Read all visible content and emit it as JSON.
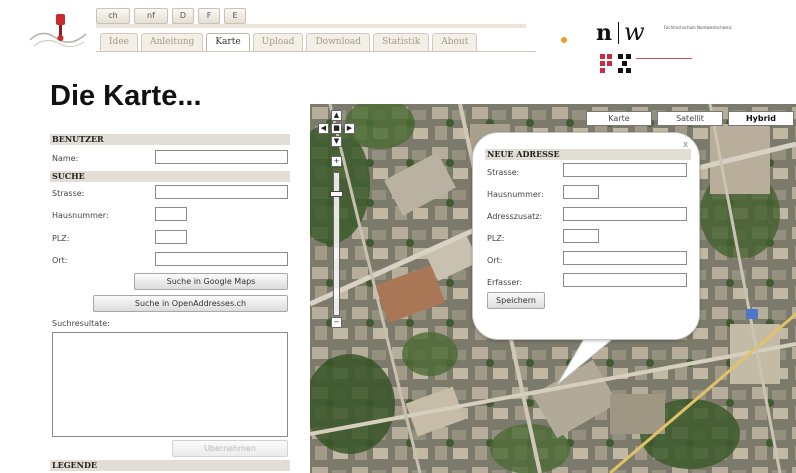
{
  "header": {
    "lang_buttons": [
      "ch",
      "nf",
      "D",
      "F",
      "E"
    ],
    "nav_tabs": [
      "Idee",
      "Anleitung",
      "Karte",
      "Upload",
      "Download",
      "Statistik",
      "About"
    ],
    "active_tab": "Karte",
    "fhnw": {
      "n": "n",
      "w": "w",
      "subtitle": "Fachhochschule Nordwestschweiz"
    }
  },
  "page": {
    "title": "Die Karte..."
  },
  "form": {
    "benutzer_head": "BENUTZER",
    "name_label": "Name:",
    "suche_head": "SUCHE",
    "strasse_label": "Strasse:",
    "hausnummer_label": "Hausnummer:",
    "plz_label": "PLZ:",
    "ort_label": "Ort:",
    "google_btn": "Suche in Google Maps",
    "openaddr_btn": "Suche in OpenAddresses.ch",
    "results_label": "Suchresultate:",
    "disabled_btn": "Ubernehmen",
    "legende_head": "LEGENDE"
  },
  "map": {
    "types": [
      "Karte",
      "Satellit",
      "Hybrid"
    ],
    "active_type": "Hybrid"
  },
  "popup": {
    "head": "NEUE ADRESSE",
    "close": "x",
    "labels": [
      "Strasse:",
      "Hausnummer:",
      "Adresszusatz:",
      "PLZ:",
      "Ort:",
      "Erfasser:"
    ],
    "save": "Speichern"
  },
  "colors": {
    "section_bg": "#e2ded6",
    "tab_text": "#a59b88",
    "fhnw_red": "#cc2b3f",
    "rss": "#f39a2b"
  }
}
